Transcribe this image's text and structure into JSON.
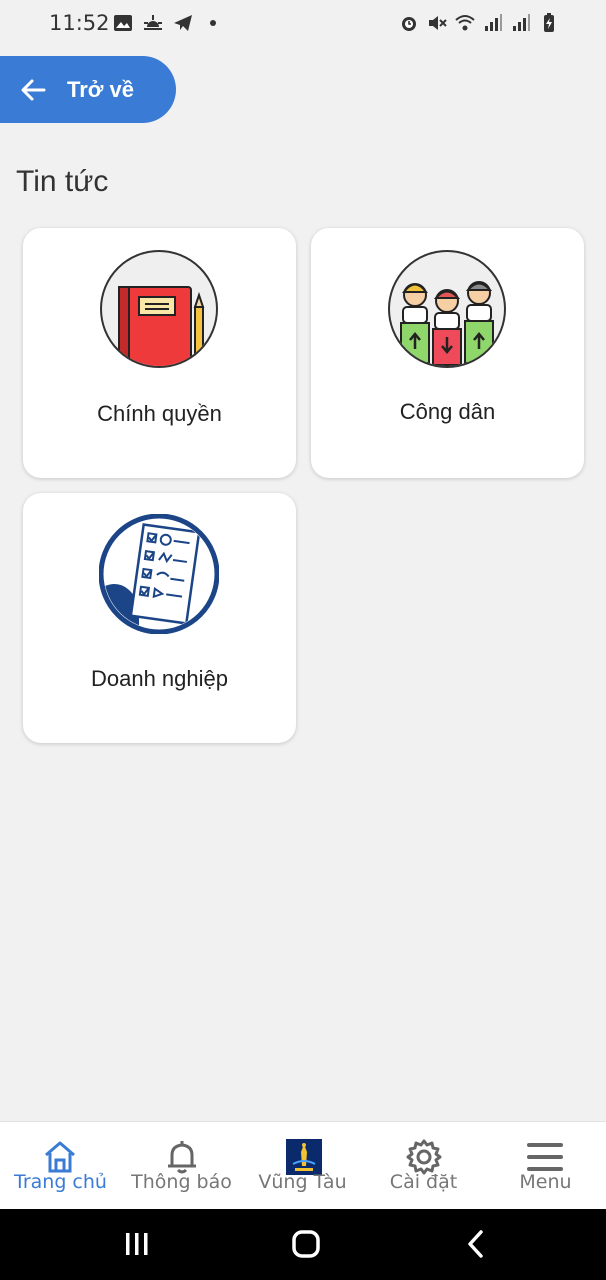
{
  "status_bar": {
    "time": "11:52",
    "left_icons": [
      "image-icon",
      "sunrise-icon",
      "telegram-icon",
      "dot-icon"
    ],
    "right_icons": [
      "alarm-icon",
      "mute-icon",
      "wifi-icon",
      "signal-icon",
      "signal-icon",
      "battery-charging-icon"
    ]
  },
  "header": {
    "back_label": "Trở về",
    "back_icon": "arrow-left-icon",
    "accent_color": "#3a7bd5"
  },
  "page": {
    "title": "Tin tức"
  },
  "categories": [
    {
      "label": "Chính quyền",
      "icon": "notebook-pencil-icon"
    },
    {
      "label": "Công dân",
      "icon": "citizens-icon"
    },
    {
      "label": "Doanh nghiệp",
      "icon": "business-checklist-icon"
    }
  ],
  "bottom_nav": [
    {
      "label": "Trang chủ",
      "icon": "home-icon",
      "active": true
    },
    {
      "label": "Thông báo",
      "icon": "bell-icon",
      "active": false
    },
    {
      "label": "Vũng Tàu",
      "icon": "vung-tau-logo-icon",
      "active": false
    },
    {
      "label": "Cài đặt",
      "icon": "gear-icon",
      "active": false
    },
    {
      "label": "Menu",
      "icon": "menu-icon",
      "active": false
    }
  ],
  "system_nav": [
    "recent-apps-icon",
    "home-circle-icon",
    "back-chevron-icon"
  ]
}
